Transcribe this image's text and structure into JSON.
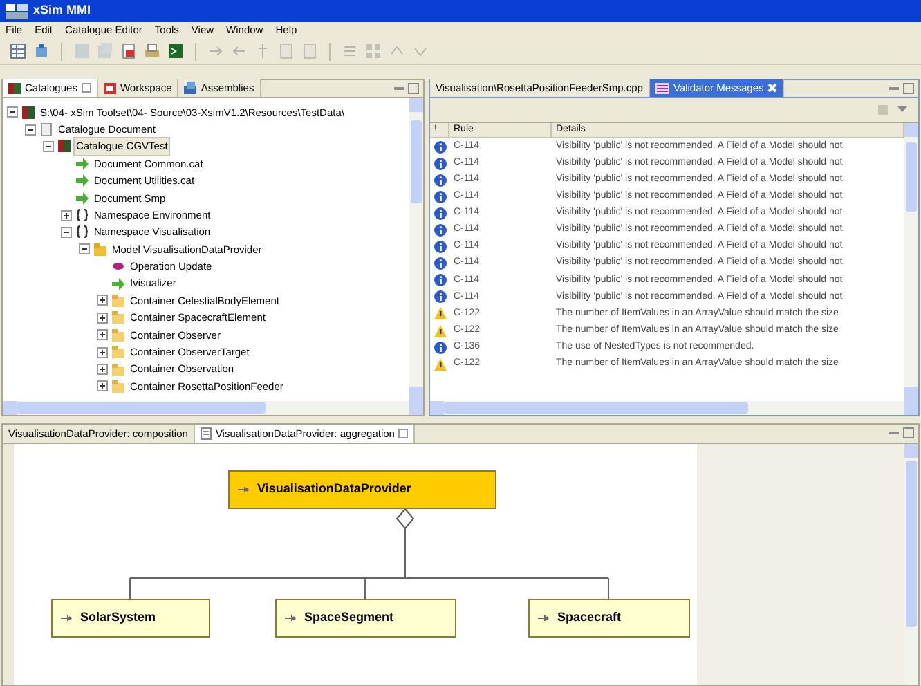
{
  "window": {
    "title": "xSim MMI"
  },
  "menu": [
    "File",
    "Edit",
    "Catalogue Editor",
    "Tools",
    "View",
    "Window",
    "Help"
  ],
  "toolbar": [
    {
      "disabled": false
    },
    {
      "disabled": false
    },
    {
      "disabled": true
    },
    {
      "disabled": true
    },
    {
      "disabled": false
    },
    {
      "disabled": false
    },
    {
      "disabled": false
    },
    {
      "disabled": true
    },
    {
      "disabled": true
    },
    {
      "disabled": true
    },
    {
      "disabled": true
    },
    {
      "disabled": true
    },
    {
      "disabled": true
    },
    {
      "disabled": true
    },
    {
      "disabled": true
    },
    {
      "disabled": true
    }
  ],
  "left_panel": {
    "tabs": [
      {
        "label": "Catalogues",
        "selected": true
      },
      {
        "label": "Workspace",
        "selected": false
      },
      {
        "label": "Assemblies",
        "selected": false
      }
    ],
    "tree": [
      {
        "label": "S:\\04- xSim Toolset\\04- Source\\03-XsimV1.2\\Resources\\TestData\\",
        "kind": "catalogue",
        "expanded": true,
        "selected": false,
        "children": [
          {
            "label": "Catalogue Document",
            "kind": "document",
            "expanded": true,
            "selected": false,
            "children": [
              {
                "label": "Catalogue CGVTest",
                "kind": "catalogue",
                "expanded": true,
                "selected": true,
                "children": [
                  {
                    "label": "Document Common.cat",
                    "kind": "link",
                    "selected": false
                  },
                  {
                    "label": "Document Utilities.cat",
                    "kind": "link",
                    "selected": false
                  },
                  {
                    "label": "Document Smp",
                    "kind": "link",
                    "selected": false
                  },
                  {
                    "label": "Namespace Environment",
                    "kind": "namespace",
                    "expanded": false,
                    "selected": false
                  },
                  {
                    "label": "Namespace Visualisation",
                    "kind": "namespace",
                    "expanded": true,
                    "selected": false,
                    "children": [
                      {
                        "label": "Model VisualisationDataProvider",
                        "kind": "model",
                        "expanded": true,
                        "selected": false,
                        "children": [
                          {
                            "label": "Operation Update",
                            "kind": "operation",
                            "selected": false
                          },
                          {
                            "label": "Ivisualizer",
                            "kind": "link",
                            "selected": false
                          },
                          {
                            "label": "Container CelestialBodyElement",
                            "kind": "container",
                            "expanded": false,
                            "selected": false
                          },
                          {
                            "label": "Container SpacecraftElement",
                            "kind": "container",
                            "expanded": false,
                            "selected": false
                          },
                          {
                            "label": "Container Observer",
                            "kind": "container",
                            "expanded": false,
                            "selected": false
                          },
                          {
                            "label": "Container ObserverTarget",
                            "kind": "container",
                            "expanded": false,
                            "selected": false
                          },
                          {
                            "label": "Container Observation",
                            "kind": "container",
                            "expanded": false,
                            "selected": false
                          },
                          {
                            "label": "Container RosettaPositionFeeder",
                            "kind": "container",
                            "expanded": false,
                            "selected": false
                          }
                        ]
                      }
                    ]
                  }
                ]
              }
            ]
          }
        ]
      }
    ]
  },
  "right_panel": {
    "tabs": [
      {
        "label": "Visualisation\\RosettaPositionFeederSmp.cpp",
        "selected": false
      },
      {
        "label": "Validator Messages",
        "selected": true
      }
    ],
    "columns": [
      "!",
      "Rule",
      "Details"
    ],
    "messages": [
      {
        "kind": "info",
        "rule": "C-114",
        "details": "Visibility 'public' is not recommended. A Field of a Model should not"
      },
      {
        "kind": "info",
        "rule": "C-114",
        "details": "Visibility 'public' is not recommended. A Field of a Model should not"
      },
      {
        "kind": "info",
        "rule": "C-114",
        "details": "Visibility 'public' is not recommended. A Field of a Model should not"
      },
      {
        "kind": "info",
        "rule": "C-114",
        "details": "Visibility 'public' is not recommended. A Field of a Model should not"
      },
      {
        "kind": "info",
        "rule": "C-114",
        "details": "Visibility 'public' is not recommended. A Field of a Model should not"
      },
      {
        "kind": "info",
        "rule": "C-114",
        "details": "Visibility 'public' is not recommended. A Field of a Model should not"
      },
      {
        "kind": "info",
        "rule": "C-114",
        "details": "Visibility 'public' is not recommended. A Field of a Model should not"
      },
      {
        "kind": "info",
        "rule": "C-114",
        "details": "Visibility 'public' is not recommended. A Field of a Model should not"
      },
      {
        "kind": "info",
        "rule": "C-114",
        "details": "Visibility 'public' is not recommended. A Field of a Model should not"
      },
      {
        "kind": "info",
        "rule": "C-114",
        "details": "Visibility 'public' is not recommended. A Field of a Model should not"
      },
      {
        "kind": "warning",
        "rule": "C-122",
        "details": "The number of ItemValues in an ArrayValue should match the size"
      },
      {
        "kind": "warning",
        "rule": "C-122",
        "details": "The number of ItemValues in an ArrayValue should match the size"
      },
      {
        "kind": "info",
        "rule": "C-136",
        "details": "The use of NestedTypes is not recommended."
      },
      {
        "kind": "warning",
        "rule": "C-122",
        "details": "The number of ItemValues in an ArrayValue should match the size"
      }
    ]
  },
  "diagram": {
    "tabs": [
      {
        "label": "VisualisationDataProvider: composition",
        "selected": false
      },
      {
        "label": "VisualisationDataProvider: aggregation",
        "selected": true
      }
    ],
    "nodes": [
      {
        "label": "VisualisationDataProvider",
        "selected": true
      },
      {
        "label": "SolarSystem",
        "selected": false
      },
      {
        "label": "SpaceSegment",
        "selected": false
      },
      {
        "label": "Spacecraft",
        "selected": false
      }
    ]
  }
}
